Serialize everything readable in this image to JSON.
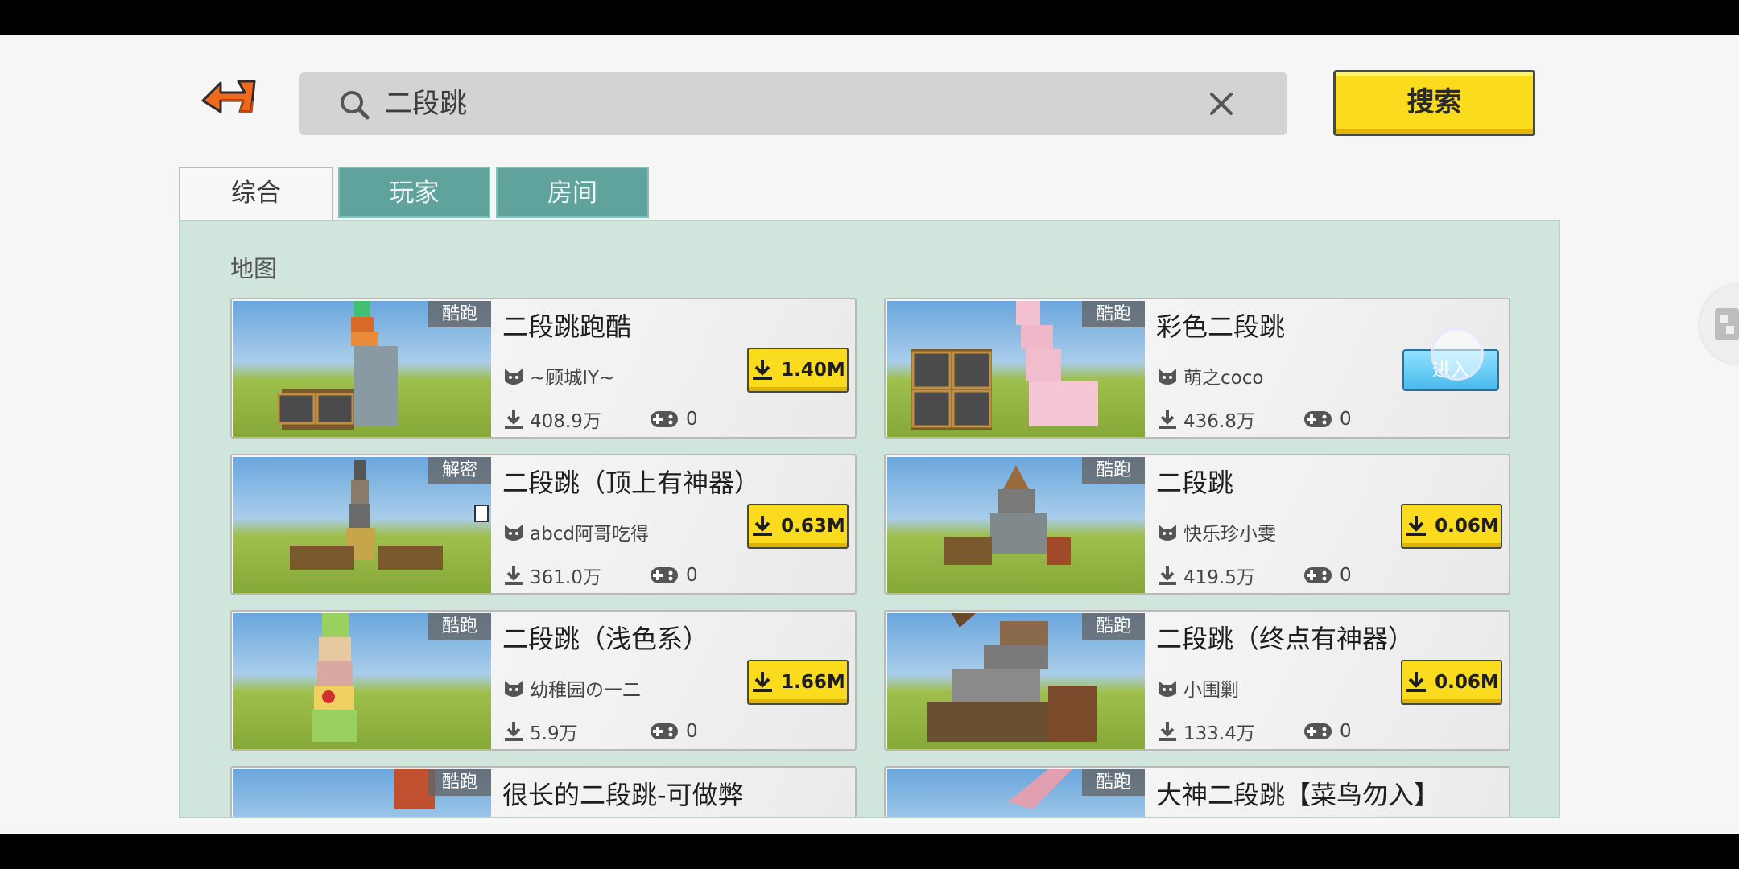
{
  "search": {
    "query": "二段跳",
    "button_label": "搜索"
  },
  "tabs": [
    {
      "label": "综合",
      "active": true
    },
    {
      "label": "玩家",
      "active": false
    },
    {
      "label": "房间",
      "active": false
    }
  ],
  "section_title": "地图",
  "maps": [
    {
      "title": "二段跳跑酷",
      "tag": "酷跑",
      "author": "~顾城IY~",
      "downloads": "408.9万",
      "players": "0",
      "size": "1.40M"
    },
    {
      "title": "彩色二段跳",
      "tag": "酷跑",
      "author": "萌之coco",
      "downloads": "436.8万",
      "players": "0",
      "action": "进入"
    },
    {
      "title": "二段跳（顶上有神器）",
      "tag": "解密",
      "author": "abcd阿哥吃得",
      "downloads": "361.0万",
      "players": "0",
      "size": "0.63M"
    },
    {
      "title": "二段跳",
      "tag": "酷跑",
      "author": "快乐珍小雯",
      "downloads": "419.5万",
      "players": "0",
      "size": "0.06M"
    },
    {
      "title": "二段跳（浅色系）",
      "tag": "酷跑",
      "author": "幼稚园の一二",
      "downloads": "5.9万",
      "players": "0",
      "size": "1.66M"
    },
    {
      "title": "二段跳（终点有神器）",
      "tag": "酷跑",
      "author": "小围剿",
      "downloads": "133.4万",
      "players": "0",
      "size": "0.06M"
    },
    {
      "title": "很长的二段跳-可做弊",
      "tag": "酷跑"
    },
    {
      "title": "大神二段跳【菜鸟勿入】",
      "tag": "酷跑"
    }
  ],
  "colors": {
    "accent_yellow": "#fadb1e",
    "tab_teal": "#5fa39c",
    "panel_green": "#d0e5db"
  }
}
